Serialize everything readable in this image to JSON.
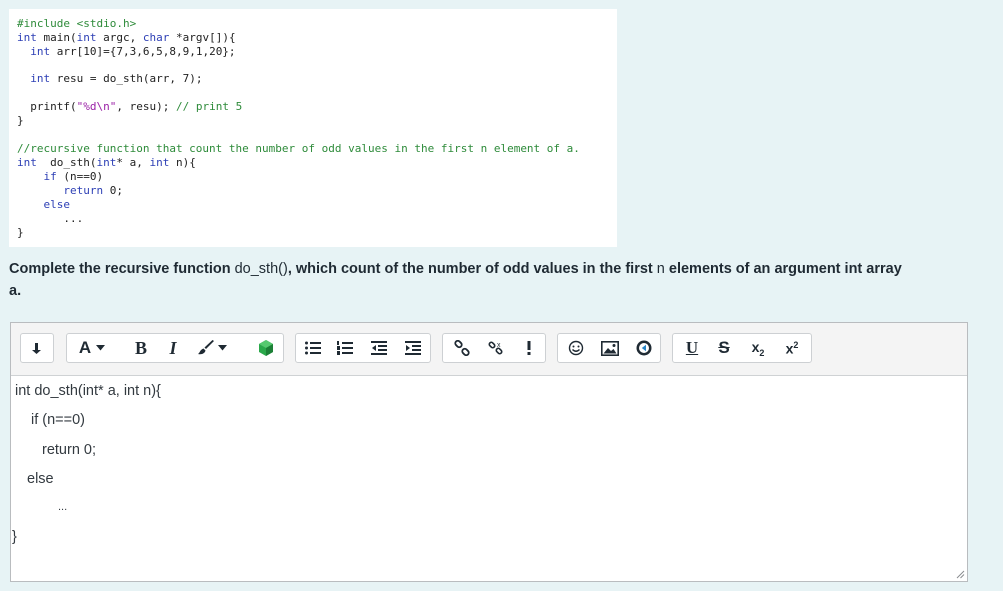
{
  "code_image": {
    "lines": [
      {
        "tokens": [
          {
            "t": "#include <stdio.h>",
            "c": "green"
          }
        ]
      },
      {
        "tokens": [
          {
            "t": "int",
            "c": "blue"
          },
          {
            "t": " main(",
            "c": "dark"
          },
          {
            "t": "int",
            "c": "blue"
          },
          {
            "t": " argc, ",
            "c": "dark"
          },
          {
            "t": "char",
            "c": "blue"
          },
          {
            "t": " *argv[]){",
            "c": "dark"
          }
        ]
      },
      {
        "tokens": [
          {
            "t": "  int",
            "c": "blue"
          },
          {
            "t": " arr[10]={7,3,6,5,8,9,1,20};",
            "c": "dark"
          }
        ]
      },
      {
        "tokens": []
      },
      {
        "tokens": [
          {
            "t": "  int",
            "c": "blue"
          },
          {
            "t": " resu = do_sth(arr, 7);",
            "c": "dark"
          }
        ]
      },
      {
        "tokens": []
      },
      {
        "tokens": [
          {
            "t": "  printf(",
            "c": "dark"
          },
          {
            "t": "\"%d\\n\"",
            "c": "magenta"
          },
          {
            "t": ", resu); ",
            "c": "dark"
          },
          {
            "t": "// print 5",
            "c": "green"
          }
        ]
      },
      {
        "tokens": [
          {
            "t": "}",
            "c": "dark"
          }
        ]
      },
      {
        "tokens": []
      },
      {
        "tokens": [
          {
            "t": "//recursive function that count the number of odd values in the first n element of a.",
            "c": "green"
          }
        ]
      },
      {
        "tokens": [
          {
            "t": "int",
            "c": "blue"
          },
          {
            "t": "  do_sth(",
            "c": "dark"
          },
          {
            "t": "int",
            "c": "blue"
          },
          {
            "t": "* a, ",
            "c": "dark"
          },
          {
            "t": "int",
            "c": "blue"
          },
          {
            "t": " n){",
            "c": "dark"
          }
        ]
      },
      {
        "tokens": [
          {
            "t": "    if",
            "c": "blue"
          },
          {
            "t": " (n==0)",
            "c": "dark"
          }
        ]
      },
      {
        "tokens": [
          {
            "t": "       return",
            "c": "blue"
          },
          {
            "t": " 0;",
            "c": "dark"
          }
        ]
      },
      {
        "tokens": [
          {
            "t": "    else",
            "c": "blue"
          }
        ]
      },
      {
        "tokens": [
          {
            "t": "       ...",
            "c": "dark"
          }
        ]
      },
      {
        "tokens": [
          {
            "t": "}",
            "c": "dark"
          }
        ]
      }
    ]
  },
  "question": {
    "part1": "Complete the recursive function ",
    "func": "do_sth()",
    "part2": ", which count of the number of odd values in the first ",
    "n": "n",
    "part3": " elements of an argument int array",
    "line2": "a."
  },
  "toolbar": {
    "font_label": "A",
    "bold_label": "B",
    "italic_label": "I",
    "unlink_badge": "x",
    "underline_label": "U",
    "strike_label": "S",
    "sub_label": "x",
    "sub_digit": "2",
    "sup_label": "x",
    "sup_digit": "2",
    "icons": [
      "collapse-icon",
      "font-icon",
      "bold-icon",
      "italic-icon",
      "brush-icon",
      "gem-icon",
      "bullet-list-icon",
      "numbered-list-icon",
      "outdent-icon",
      "indent-icon",
      "link-icon",
      "unlink-icon",
      "exclamation-icon",
      "emoticon-icon",
      "image-icon",
      "media-icon",
      "underline-icon",
      "strikethrough-icon",
      "subscript-icon",
      "superscript-icon"
    ]
  },
  "editor": {
    "lines": [
      "int do_sth(int* a, int n){",
      "if (n==0)",
      "return 0;",
      "else",
      "...",
      "}"
    ]
  },
  "colors": {
    "page_bg": "#e7f3f5",
    "code_green": "#2e8b3a",
    "code_blue": "#2d3fb5",
    "code_magenta": "#9a1fa6",
    "gem_green": "#2aa84a"
  }
}
